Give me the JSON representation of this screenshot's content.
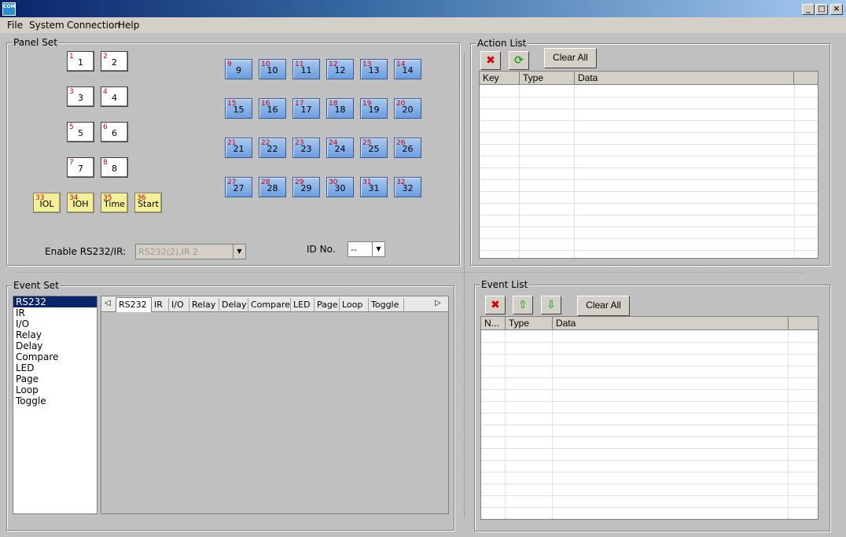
{
  "window": {
    "icon_text": "COM",
    "controls": [
      "_",
      "□",
      "×"
    ]
  },
  "menu": [
    "File",
    "System",
    "Connection",
    "Help"
  ],
  "panel_set": {
    "title": "Panel Set",
    "white_buttons": [
      {
        "idx": "1",
        "label": "1"
      },
      {
        "idx": "2",
        "label": "2"
      },
      {
        "idx": "3",
        "label": "3"
      },
      {
        "idx": "4",
        "label": "4"
      },
      {
        "idx": "5",
        "label": "5"
      },
      {
        "idx": "6",
        "label": "6"
      },
      {
        "idx": "7",
        "label": "7"
      },
      {
        "idx": "8",
        "label": "8"
      }
    ],
    "blue_buttons": [
      {
        "idx": "9",
        "label": "9"
      },
      {
        "idx": "10",
        "label": "10"
      },
      {
        "idx": "11",
        "label": "11"
      },
      {
        "idx": "12",
        "label": "12"
      },
      {
        "idx": "13",
        "label": "13"
      },
      {
        "idx": "14",
        "label": "14"
      },
      {
        "idx": "15",
        "label": "15"
      },
      {
        "idx": "16",
        "label": "16"
      },
      {
        "idx": "17",
        "label": "17"
      },
      {
        "idx": "18",
        "label": "18"
      },
      {
        "idx": "19",
        "label": "19"
      },
      {
        "idx": "20",
        "label": "20"
      },
      {
        "idx": "21",
        "label": "21"
      },
      {
        "idx": "22",
        "label": "22"
      },
      {
        "idx": "23",
        "label": "23"
      },
      {
        "idx": "24",
        "label": "24"
      },
      {
        "idx": "25",
        "label": "25"
      },
      {
        "idx": "26",
        "label": "26"
      },
      {
        "idx": "27",
        "label": "27"
      },
      {
        "idx": "28",
        "label": "28"
      },
      {
        "idx": "29",
        "label": "29"
      },
      {
        "idx": "30",
        "label": "30"
      },
      {
        "idx": "31",
        "label": "31"
      },
      {
        "idx": "32",
        "label": "32"
      }
    ],
    "yellow_buttons": [
      {
        "idx": "33",
        "label": "IOL"
      },
      {
        "idx": "34",
        "label": "IOH"
      },
      {
        "idx": "35",
        "label": "Time"
      },
      {
        "idx": "36",
        "label": "Start"
      }
    ],
    "enable_label": "Enable RS232/IR:",
    "enable_value": "RS232(2),IR 2",
    "id_label": "ID No.",
    "id_value": "--"
  },
  "action_list": {
    "title": "Action List",
    "clear_label": "Clear All",
    "columns": [
      "Key",
      "Type",
      "Data"
    ]
  },
  "event_set": {
    "title": "Event Set",
    "items": [
      "RS232",
      "IR",
      "I/O",
      "Relay",
      "Delay",
      "Compare",
      "LED",
      "Page",
      "Loop",
      "Toggle"
    ],
    "selected": "RS232",
    "tabs": [
      "RS232",
      "IR",
      "I/O",
      "Relay",
      "Delay",
      "Compare",
      "LED",
      "Page",
      "Loop",
      "Toggle"
    ]
  },
  "event_list": {
    "title": "Event List",
    "clear_label": "Clear All",
    "columns": [
      "N...",
      "Type",
      "Data"
    ]
  },
  "colors": {
    "titlebar_start": "#0a246a",
    "selection": "#0a246a",
    "blue_button": "#6a9ee0",
    "yellow_button": "#f4f09a",
    "index_red": "#d00000"
  }
}
